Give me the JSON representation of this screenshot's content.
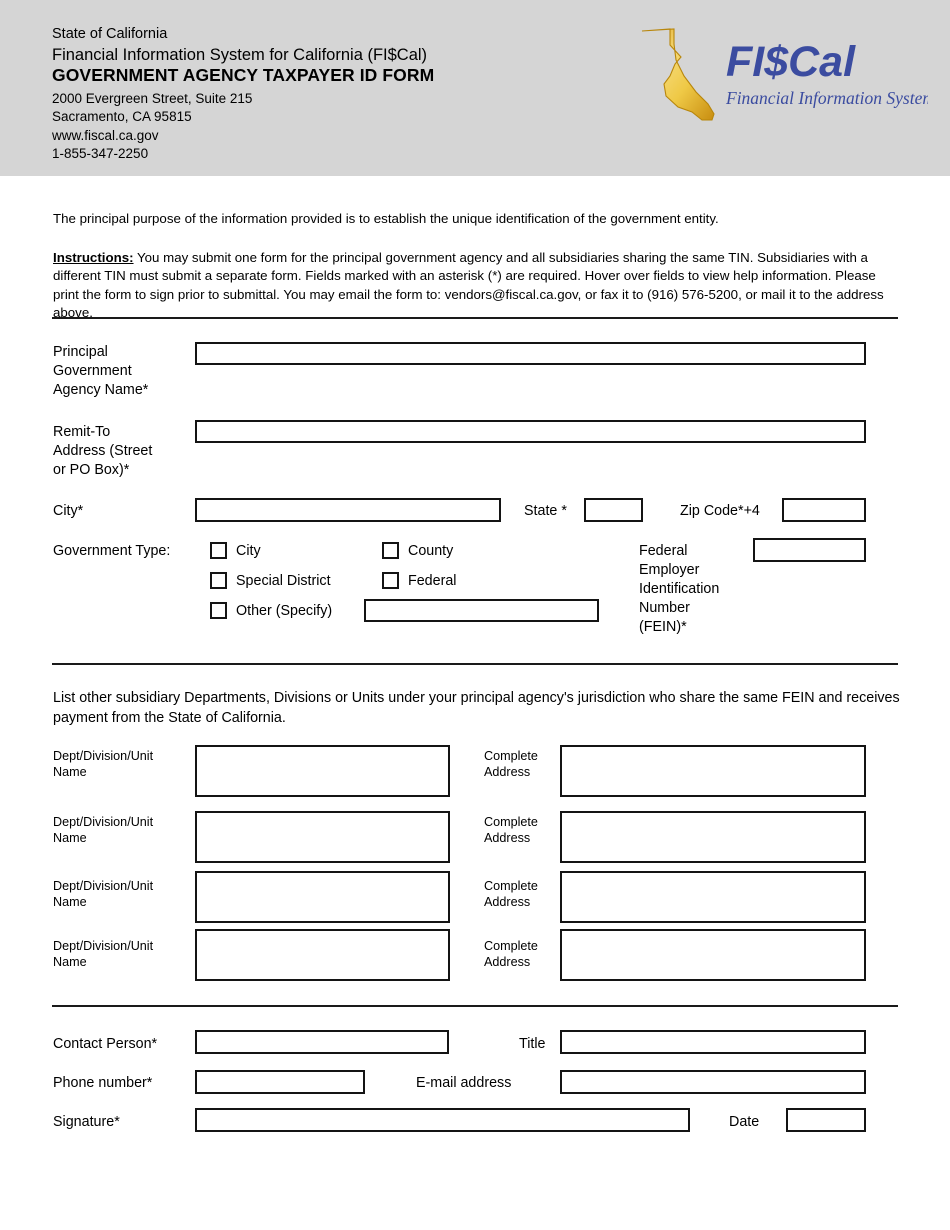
{
  "header": {
    "line1": "State of California",
    "line2": "Financial Information System for California (FI$Cal)",
    "title": "GOVERNMENT AGENCY TAXPAYER ID FORM",
    "street": "2000 Evergreen Street, Suite 215",
    "city_state_zip": "Sacramento, CA 95815",
    "website": "www.fiscal.ca.gov",
    "phone": "1-855-347-2250"
  },
  "logo": {
    "wordmark": "FI$Cal",
    "tagline": "Financial Information System for California",
    "state_shape": "california-state-outline",
    "gold": "#E8B324",
    "blue": "#3B4CA0"
  },
  "body": {
    "purpose": "The principal purpose of the information provided is to establish the unique identification of the government entity.",
    "instructions_lead": "Instructions:",
    "instructions_text": " You may submit one form for the principal government agency and all subsidiaries sharing the same TIN. Subsidiaries with a different TIN must submit a separate form. Fields marked with an asterisk (*) are required. Hover over fields to view help information. Please print the form to sign prior to submittal. You may email the form to: vendors@fiscal.ca.gov, or fax it to (916) 576-5200, or mail it to the address above."
  },
  "section_principal": {
    "agency_name_label": "Principal\nGovernment\nAgency Name*",
    "agency_name_value": "",
    "remit_address_label": "Remit-To\nAddress (Street\nor PO Box)*",
    "remit_address_value": "",
    "city_label": "City*",
    "city_value": "",
    "state_label": "State *",
    "state_value": "",
    "zip_label": "Zip Code*+4",
    "zip_value": "",
    "gov_type_label": "Government Type:",
    "checkboxes": [
      {
        "label": "City",
        "checked": false
      },
      {
        "label": "County",
        "checked": false
      },
      {
        "label": "Special District",
        "checked": false
      },
      {
        "label": "Federal",
        "checked": false
      },
      {
        "label": "Other (Specify)",
        "checked": false
      }
    ],
    "other_specify_value": "",
    "fein_label": "Federal\nEmployer\nIdentification\nNumber\n(FEIN)*",
    "fein_value": ""
  },
  "section_subsidiaries": {
    "intro": "List other subsidiary Departments, Divisions or Units under your principal agency's jurisdiction who share the same FEIN and receives payment from the State of California.",
    "rows": [
      {
        "name_label": "Dept/Division/Unit\nName",
        "name_value": "",
        "address_label": "Complete\nAddress",
        "address_value": ""
      },
      {
        "name_label": "Dept/Division/Unit\nName",
        "name_value": "",
        "address_label": "Complete\nAddress",
        "address_value": ""
      },
      {
        "name_label": "Dept/Division/Unit\nName",
        "name_value": "",
        "address_label": "Complete\nAddress",
        "address_value": ""
      },
      {
        "name_label": "Dept/Division/Unit\nName",
        "name_value": "",
        "address_label": "Complete\nAddress",
        "address_value": ""
      }
    ]
  },
  "section_contact": {
    "contact_person_label": "Contact Person*",
    "contact_person_value": "",
    "title_label": "Title",
    "title_value": "",
    "phone_label": "Phone number*",
    "phone_value": "",
    "email_label": "E-mail address",
    "email_value": "",
    "signature_label": "Signature*",
    "signature_value": "",
    "date_label": "Date",
    "date_value": ""
  }
}
